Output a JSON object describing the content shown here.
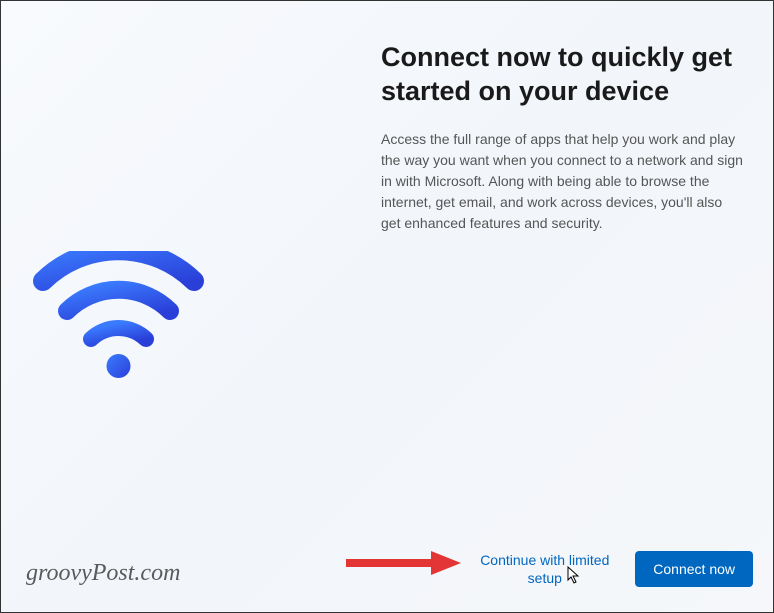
{
  "main": {
    "title": "Connect now to quickly get started on your device",
    "description": "Access the full range of apps that help you work and play the way you want when you connect to a network and sign in with Microsoft. Along with being able to browse the internet, get email, and work across devices, you'll also get enhanced features and security."
  },
  "footer": {
    "limited_setup_label": "Continue with limited setup",
    "connect_button_label": "Connect now"
  },
  "watermark": "groovyPost.com"
}
